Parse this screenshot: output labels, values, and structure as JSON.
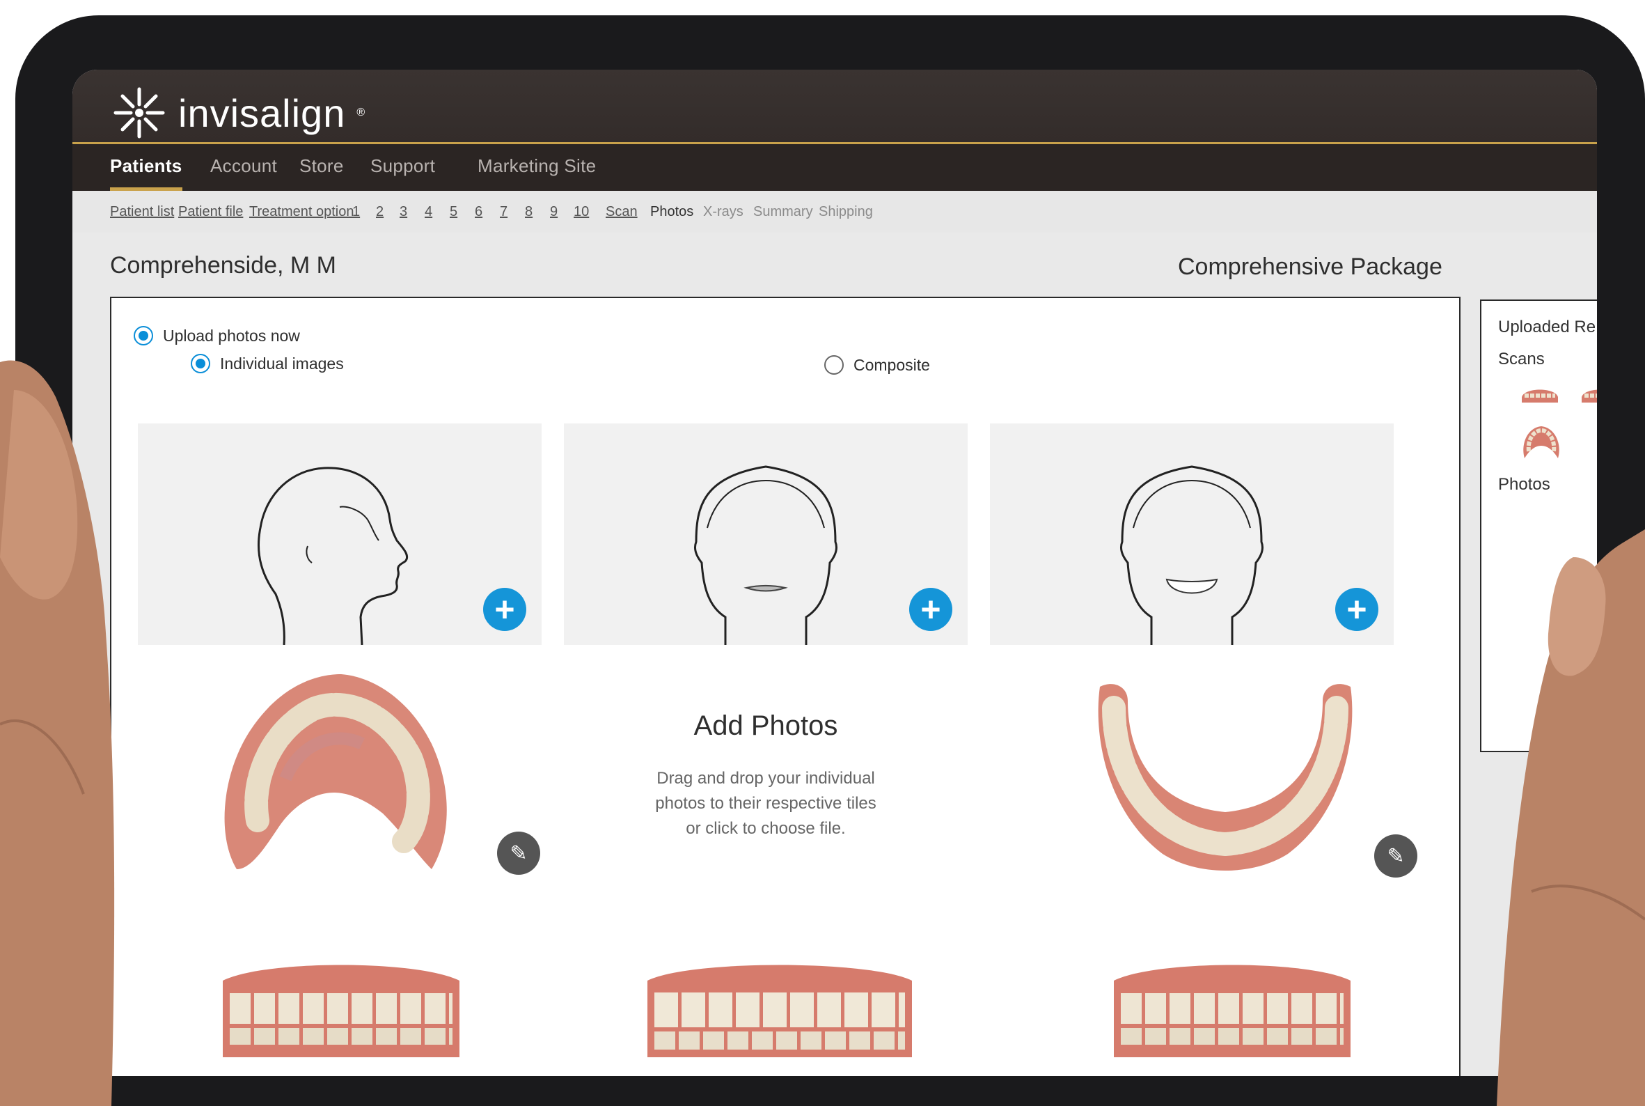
{
  "app": {
    "brand": "invisalign",
    "brand_mark": "®"
  },
  "nav": {
    "items": [
      {
        "label": "Patients",
        "active": true
      },
      {
        "label": "Account",
        "active": false
      },
      {
        "label": "Store",
        "active": false
      },
      {
        "label": "Support",
        "active": false
      },
      {
        "label": "Marketing Site",
        "active": false
      }
    ]
  },
  "breadcrumb": {
    "items": [
      {
        "label": "Patient list",
        "state": "link"
      },
      {
        "label": "Patient file",
        "state": "link"
      },
      {
        "label": "Treatment option",
        "state": "link"
      },
      {
        "label": "1",
        "state": "link"
      },
      {
        "label": "2",
        "state": "link"
      },
      {
        "label": "3",
        "state": "link"
      },
      {
        "label": "4",
        "state": "link"
      },
      {
        "label": "5",
        "state": "link"
      },
      {
        "label": "6",
        "state": "link"
      },
      {
        "label": "7",
        "state": "link"
      },
      {
        "label": "8",
        "state": "link"
      },
      {
        "label": "9",
        "state": "link"
      },
      {
        "label": "10",
        "state": "link"
      },
      {
        "label": "Scan",
        "state": "link"
      },
      {
        "label": "Photos",
        "state": "current"
      },
      {
        "label": "X-rays",
        "state": "dim"
      },
      {
        "label": "Summary",
        "state": "dim"
      },
      {
        "label": "Shipping",
        "state": "dim"
      }
    ]
  },
  "patient": {
    "name": "Comprehenside, M M",
    "package": "Comprehensive Package"
  },
  "upload": {
    "mode_label": "Upload photos now",
    "individual_label": "Individual images",
    "composite_label": "Composite",
    "add_title": "Add Photos",
    "add_desc_1": "Drag and drop your individual",
    "add_desc_2": "photos to their respective tiles",
    "add_desc_3": "or click to choose file."
  },
  "side_panel": {
    "title": "Uploaded Re",
    "scans_label": "Scans",
    "photos_label": "Photos"
  },
  "colors": {
    "accent": "#1595d8",
    "header": "#3a3331",
    "gold": "#c9a24b"
  }
}
